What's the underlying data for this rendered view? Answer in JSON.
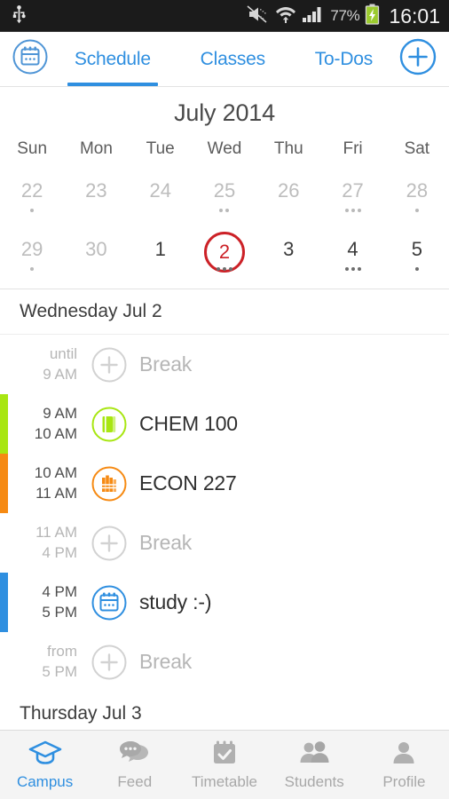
{
  "status_bar": {
    "usb_icon": "usb-icon",
    "mute_icon": "mute-icon",
    "wifi_icon": "wifi-icon",
    "signal_icon": "signal-bars-icon",
    "battery_percent": "77%",
    "battery_icon": "battery-charging-icon",
    "time": "16:01"
  },
  "tab_bar": {
    "calendar_icon": "calendar-icon",
    "add_icon": "plus-circle-icon",
    "tabs": [
      {
        "label": "Schedule",
        "active": true
      },
      {
        "label": "Classes",
        "active": false
      },
      {
        "label": "To-Dos",
        "active": false
      }
    ],
    "accent_color": "#2f8fe0"
  },
  "calendar": {
    "month_title": "July 2014",
    "weekdays": [
      "Sun",
      "Mon",
      "Tue",
      "Wed",
      "Thu",
      "Fri",
      "Sat"
    ],
    "selected_color": "#cc2127",
    "weeks": [
      [
        {
          "day": "22",
          "muted": true,
          "selected": false,
          "dots": 1
        },
        {
          "day": "23",
          "muted": true,
          "selected": false,
          "dots": 0
        },
        {
          "day": "24",
          "muted": true,
          "selected": false,
          "dots": 0
        },
        {
          "day": "25",
          "muted": true,
          "selected": false,
          "dots": 2
        },
        {
          "day": "26",
          "muted": true,
          "selected": false,
          "dots": 0
        },
        {
          "day": "27",
          "muted": true,
          "selected": false,
          "dots": 3
        },
        {
          "day": "28",
          "muted": true,
          "selected": false,
          "dots": 1
        }
      ],
      [
        {
          "day": "29",
          "muted": true,
          "selected": false,
          "dots": 1
        },
        {
          "day": "30",
          "muted": true,
          "selected": false,
          "dots": 0
        },
        {
          "day": "1",
          "muted": false,
          "selected": false,
          "dots": 0
        },
        {
          "day": "2",
          "muted": false,
          "selected": true,
          "dots": 3
        },
        {
          "day": "3",
          "muted": false,
          "selected": false,
          "dots": 0
        },
        {
          "day": "4",
          "muted": false,
          "selected": false,
          "dots": 3
        },
        {
          "day": "5",
          "muted": false,
          "selected": false,
          "dots": 1
        }
      ]
    ]
  },
  "schedule": {
    "days": [
      {
        "header": "Wednesday Jul 2",
        "events": [
          {
            "time_top": "until",
            "time_bottom": "9 AM",
            "title": "Break",
            "type": "break",
            "icon": "plus-circle-icon",
            "accent_color": "transparent",
            "icon_color": "#d2d2d2"
          },
          {
            "time_top": "9 AM",
            "time_bottom": "10 AM",
            "title": "CHEM 100",
            "type": "class",
            "icon": "book-icon",
            "accent_color": "#a8e612",
            "icon_color": "#a8e612"
          },
          {
            "time_top": "10 AM",
            "time_bottom": "11 AM",
            "title": "ECON 227",
            "type": "class",
            "icon": "books-icon",
            "accent_color": "#f68a13",
            "icon_color": "#f68a13"
          },
          {
            "time_top": "11 AM",
            "time_bottom": "4 PM",
            "title": "Break",
            "type": "break",
            "icon": "plus-circle-icon",
            "accent_color": "transparent",
            "icon_color": "#d2d2d2"
          },
          {
            "time_top": "4 PM",
            "time_bottom": "5 PM",
            "title": "study :-)",
            "type": "event",
            "icon": "calendar-icon",
            "accent_color": "#2f8fe0",
            "icon_color": "#2f8fe0"
          },
          {
            "time_top": "from",
            "time_bottom": "5 PM",
            "title": "Break",
            "type": "break",
            "icon": "plus-circle-icon",
            "accent_color": "transparent",
            "icon_color": "#d2d2d2"
          }
        ]
      },
      {
        "header": "Thursday Jul 3",
        "events": []
      }
    ]
  },
  "bottom_nav": {
    "active_color": "#2f8fe0",
    "inactive_color": "#a8a8a8",
    "items": [
      {
        "label": "Campus",
        "icon": "graduation-cap-icon",
        "active": true
      },
      {
        "label": "Feed",
        "icon": "chat-bubbles-icon",
        "active": false
      },
      {
        "label": "Timetable",
        "icon": "calendar-check-icon",
        "active": false
      },
      {
        "label": "Students",
        "icon": "people-icon",
        "active": false
      },
      {
        "label": "Profile",
        "icon": "person-icon",
        "active": false
      }
    ]
  }
}
